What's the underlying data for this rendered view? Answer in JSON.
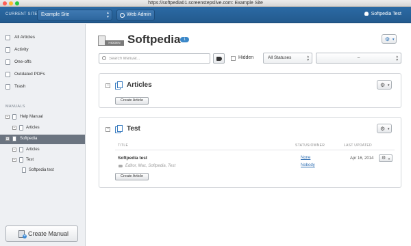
{
  "window": {
    "title": "https://softpedia01.screenstepslive.com: Example Site"
  },
  "topbar": {
    "current_site_label": "CURRENT SITE",
    "site_value": "Example Site",
    "web_admin_label": "Web Admin",
    "user_name": "Softpedia Test"
  },
  "sidebar": {
    "items": [
      {
        "label": "All Articles",
        "icon": "all-articles-icon"
      },
      {
        "label": "Activity",
        "icon": "activity-icon"
      },
      {
        "label": "One-offs",
        "icon": "one-offs-icon"
      },
      {
        "label": "Outdated PDFs",
        "icon": "outdated-pdfs-icon"
      },
      {
        "label": "Trash",
        "icon": "trash-icon"
      }
    ],
    "manuals_label": "MANUALS",
    "tree": [
      {
        "label": "Help Manual"
      },
      {
        "label": "Articles"
      },
      {
        "label": "Softpedia"
      },
      {
        "label": "Articles"
      },
      {
        "label": "Test"
      },
      {
        "label": "Softpedia test"
      }
    ],
    "create_manual_label": "Create Manual"
  },
  "main": {
    "hidden_tag": "HIDDEN",
    "title": "Softpedia",
    "count": "1",
    "search_placeholder": "Search Manual...",
    "hidden_checkbox_label": "Hidden",
    "status_select": "All Statuses",
    "second_select": "–",
    "panels": [
      {
        "title": "Articles",
        "button": "Create Article"
      },
      {
        "title": "Test",
        "button": "Create Article",
        "columns": {
          "title": "TITLE",
          "status_owner": "STATUS/OWNER",
          "last_updated": "LAST UPDATED"
        },
        "rows": [
          {
            "title": "Softpedia test",
            "tags": "Editor, Mac, Softpedia, Test",
            "status": "None",
            "owner": "Nobody",
            "last_updated": "Apr 16, 2014"
          }
        ]
      }
    ]
  },
  "colors": {
    "accent": "#2b6aa5",
    "link": "#2f6fb3",
    "badge": "#3a87c8",
    "active_tree": "#6b7480"
  }
}
